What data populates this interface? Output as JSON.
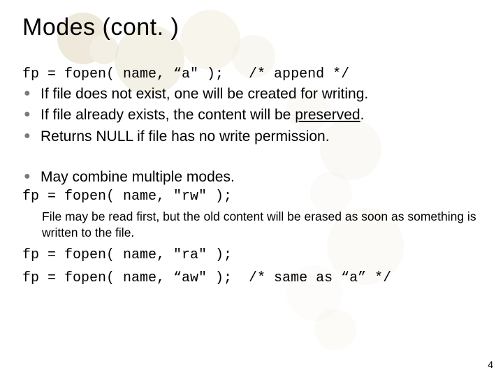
{
  "title": "Modes (cont. )",
  "code1": "fp = fopen( name, “a\" );   /* append */",
  "bullets1": {
    "b0": "If file does not exist, one will be created for writing.",
    "b1_pre": "If file already exists, the content will be ",
    "b1_under": "preserved",
    "b1_post": ".",
    "b2": "Returns NULL if file has no write permission."
  },
  "bullets2": {
    "b0": "May combine multiple modes."
  },
  "code2": "fp = fopen( name, \"rw\" );",
  "note": "File may be read first, but the old content will be erased as soon as something is written to the file.",
  "code3": "fp = fopen( name, \"ra\" );",
  "code4": "fp = fopen( name, “aw\" );  /* same as “a” */",
  "pagenum": "4"
}
